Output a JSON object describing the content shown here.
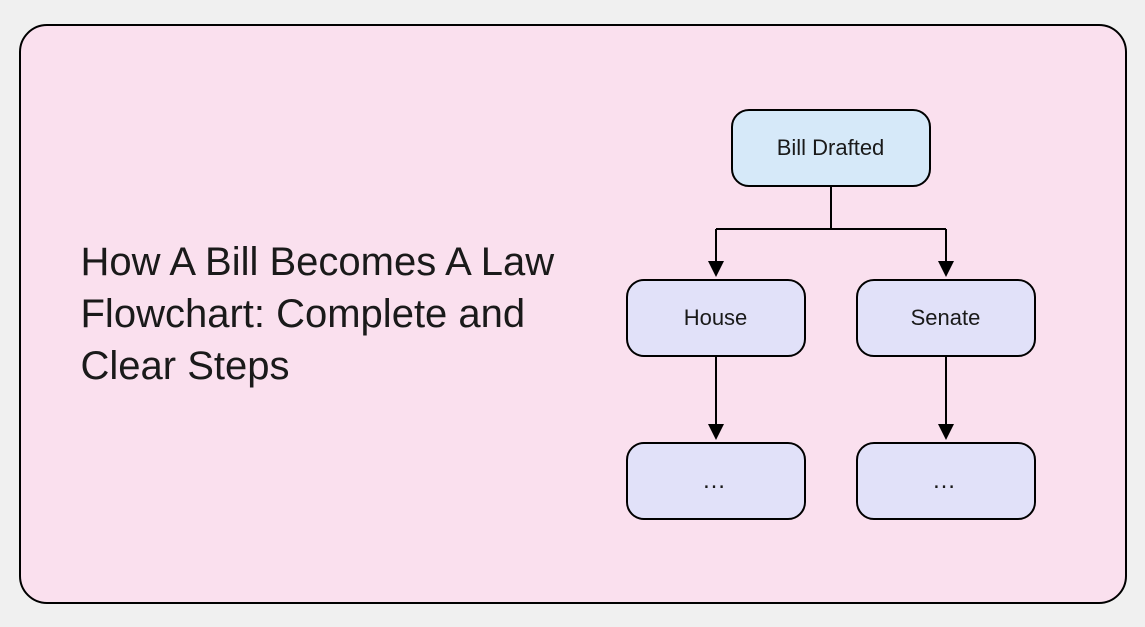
{
  "title": "How A Bill Becomes A Law Flowchart: Complete and Clear Steps",
  "flowchart": {
    "top": "Bill Drafted",
    "midLeft": "House",
    "midRight": "Senate",
    "bottomLeft": "…",
    "bottomRight": "…"
  }
}
